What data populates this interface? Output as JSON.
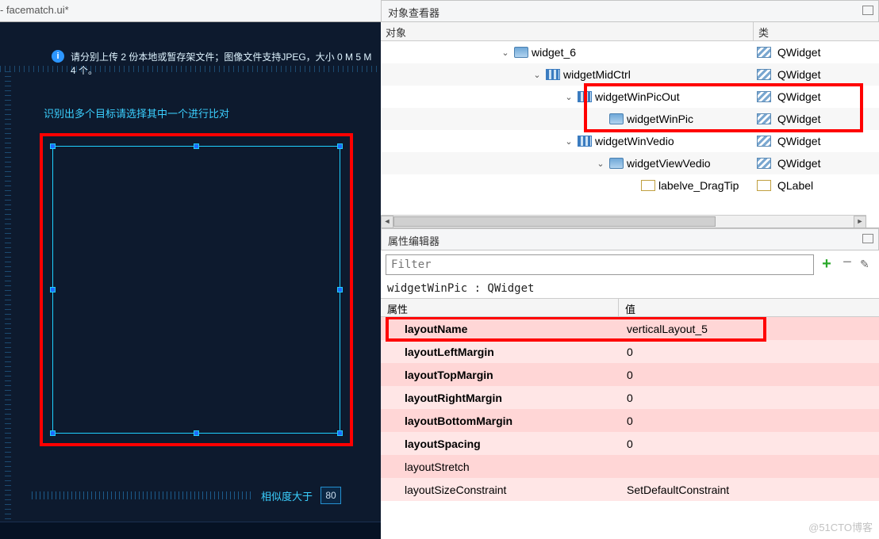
{
  "titlebar": {
    "filename": "- facematch.ui*"
  },
  "canvas": {
    "upload_hint": "请分别上传 2 份本地或暂存架文件；图像文件支持JPEG，大小 0 M  5 M 4 个。",
    "multi_target_hint": "识别出多个目标请选择其中一个进行比对",
    "similarity_label": "相似度大于",
    "similarity_value": "80"
  },
  "object_inspector": {
    "title": "对象查看器",
    "col_object": "对象",
    "col_class": "类",
    "rows": [
      {
        "indent": 150,
        "expand": true,
        "icon": "widget",
        "name": "widget_6",
        "cls": "QWidget"
      },
      {
        "indent": 190,
        "expand": true,
        "icon": "vlayout",
        "name": "widgetMidCtrl",
        "cls": "QWidget"
      },
      {
        "indent": 230,
        "expand": true,
        "icon": "vlayout",
        "name": "widgetWinPicOut",
        "cls": "QWidget"
      },
      {
        "indent": 270,
        "expand": false,
        "icon": "widget",
        "name": "widgetWinPic",
        "cls": "QWidget"
      },
      {
        "indent": 230,
        "expand": true,
        "icon": "vlayout",
        "name": "widgetWinVedio",
        "cls": "QWidget"
      },
      {
        "indent": 270,
        "expand": true,
        "icon": "widget",
        "name": "widgetViewVedio",
        "cls": "QWidget"
      },
      {
        "indent": 310,
        "expand": false,
        "icon": "label",
        "name": "labelve_DragTip",
        "cls": "QLabel"
      }
    ]
  },
  "property_editor": {
    "title": "属性编辑器",
    "filter_placeholder": "Filter",
    "object_path": "widgetWinPic : QWidget",
    "col_prop": "属性",
    "col_val": "值",
    "rows": [
      {
        "name": "layoutName",
        "value": "verticalLayout_5",
        "bold": true
      },
      {
        "name": "layoutLeftMargin",
        "value": "0",
        "bold": true
      },
      {
        "name": "layoutTopMargin",
        "value": "0",
        "bold": true
      },
      {
        "name": "layoutRightMargin",
        "value": "0",
        "bold": true
      },
      {
        "name": "layoutBottomMargin",
        "value": "0",
        "bold": true
      },
      {
        "name": "layoutSpacing",
        "value": "0",
        "bold": true
      },
      {
        "name": "layoutStretch",
        "value": "",
        "bold": false
      },
      {
        "name": "layoutSizeConstraint",
        "value": "SetDefaultConstraint",
        "bold": false
      }
    ]
  },
  "watermark": "@51CTO博客"
}
